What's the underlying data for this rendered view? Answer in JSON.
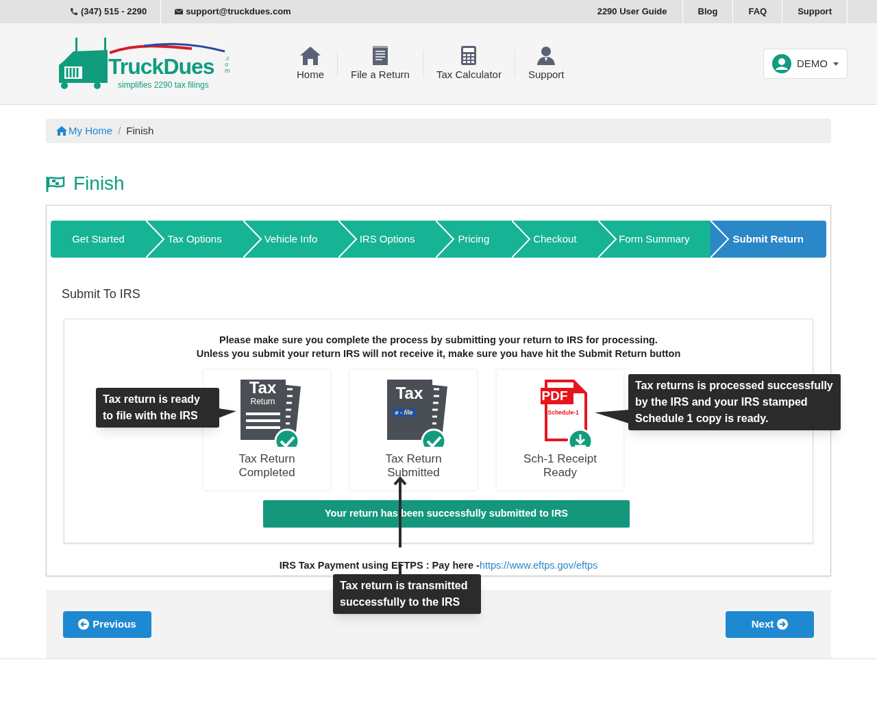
{
  "top_bar": {
    "phone": "(347) 515 - 2290",
    "email": "support@truckdues.com",
    "links": [
      "2290 User Guide",
      "Blog",
      "FAQ",
      "Support"
    ]
  },
  "logo": {
    "name": "TruckDues",
    "suffix": ".com",
    "tagline": "simplifies 2290 tax filings"
  },
  "nav": [
    {
      "label": "Home",
      "kind": "home"
    },
    {
      "label": "File a Return",
      "kind": "file"
    },
    {
      "label": "Tax Calculator",
      "kind": "calc"
    },
    {
      "label": "Support",
      "kind": "support"
    }
  ],
  "user_menu": {
    "label": "DEMO"
  },
  "breadcrumb": [
    "My Home",
    "Finish"
  ],
  "breadcrumb_separator": "/",
  "page_title": "Finish",
  "steps": [
    {
      "label": "Get Started",
      "selected": false
    },
    {
      "label": "Tax Options",
      "selected": false
    },
    {
      "label": "Vehicle Info",
      "selected": false
    },
    {
      "label": "IRS Options",
      "selected": false
    },
    {
      "label": "Pricing",
      "selected": false
    },
    {
      "label": "Checkout",
      "selected": false
    },
    {
      "label": "Form Summary",
      "selected": false
    },
    {
      "label": "Submit Return",
      "selected": true
    }
  ],
  "section_title": "Submit To IRS",
  "notice": [
    "Please make sure you complete the process by submitting your return to IRS for processing.",
    "Unless you submit your return IRS will not receive it, make sure you have hit the Submit Return button"
  ],
  "cards": [
    {
      "kind": "completed",
      "icon_text": [
        "Tax",
        "Return"
      ],
      "label": "Tax Return Completed"
    },
    {
      "kind": "submitted",
      "icon_text": [
        "Tax",
        "e - file"
      ],
      "label": "Tax Return Submitted"
    },
    {
      "kind": "receipt",
      "icon_text": [
        "PDF",
        "Schedule-1"
      ],
      "label": "Sch-1 Receipt Ready"
    }
  ],
  "success_banner": "Your return has been successfully submitted to IRS",
  "payment": {
    "text": "IRS Tax Payment using EFTPS : Pay here -",
    "link": "https://www.eftps.gov/eftps"
  },
  "callouts": [
    {
      "kind": "left",
      "text": "Tax return is ready to file with the IRS"
    },
    {
      "kind": "right",
      "text": "Tax returns is processed successfully by the IRS and your IRS stamped Schedule 1 copy is ready."
    },
    {
      "kind": "bottom",
      "text": "Tax return is transmitted successfully to the IRS"
    }
  ],
  "buttons": {
    "previous": "Previous",
    "next": "Next"
  }
}
